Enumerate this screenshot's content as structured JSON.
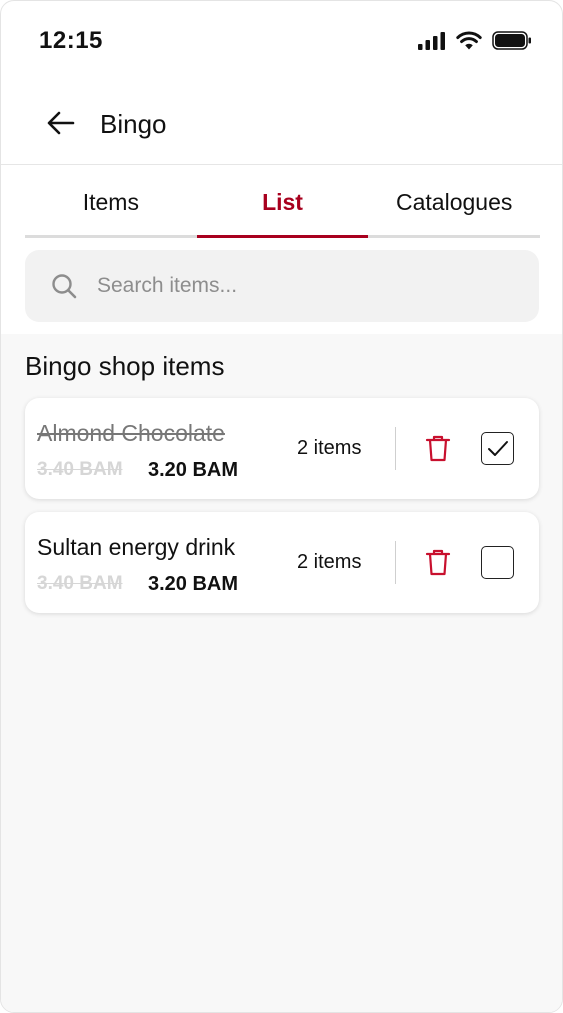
{
  "status_bar": {
    "time": "12:15"
  },
  "header": {
    "title": "Bingo"
  },
  "tabs": [
    {
      "label": "Items",
      "active": false
    },
    {
      "label": "List",
      "active": true
    },
    {
      "label": "Catalogues",
      "active": false
    }
  ],
  "search": {
    "placeholder": "Search items...",
    "value": ""
  },
  "section": {
    "title": "Bingo shop items"
  },
  "items": [
    {
      "name": "Almond Chocolate",
      "old_price": "3.40 BAM",
      "new_price": "3.20 BAM",
      "quantity": "2 items",
      "checked": true
    },
    {
      "name": "Sultan energy drink",
      "old_price": "3.40 BAM",
      "new_price": "3.20 BAM",
      "quantity": "2 items",
      "checked": false
    }
  ],
  "icons": {
    "back": "arrow-left-icon",
    "search": "search-icon",
    "delete": "trash-icon",
    "signal": "signal-icon",
    "wifi": "wifi-icon",
    "battery": "battery-icon"
  },
  "colors": {
    "accent": "#a8001e",
    "background": "#f8f8f8",
    "muted_text": "#8d8d8d"
  }
}
